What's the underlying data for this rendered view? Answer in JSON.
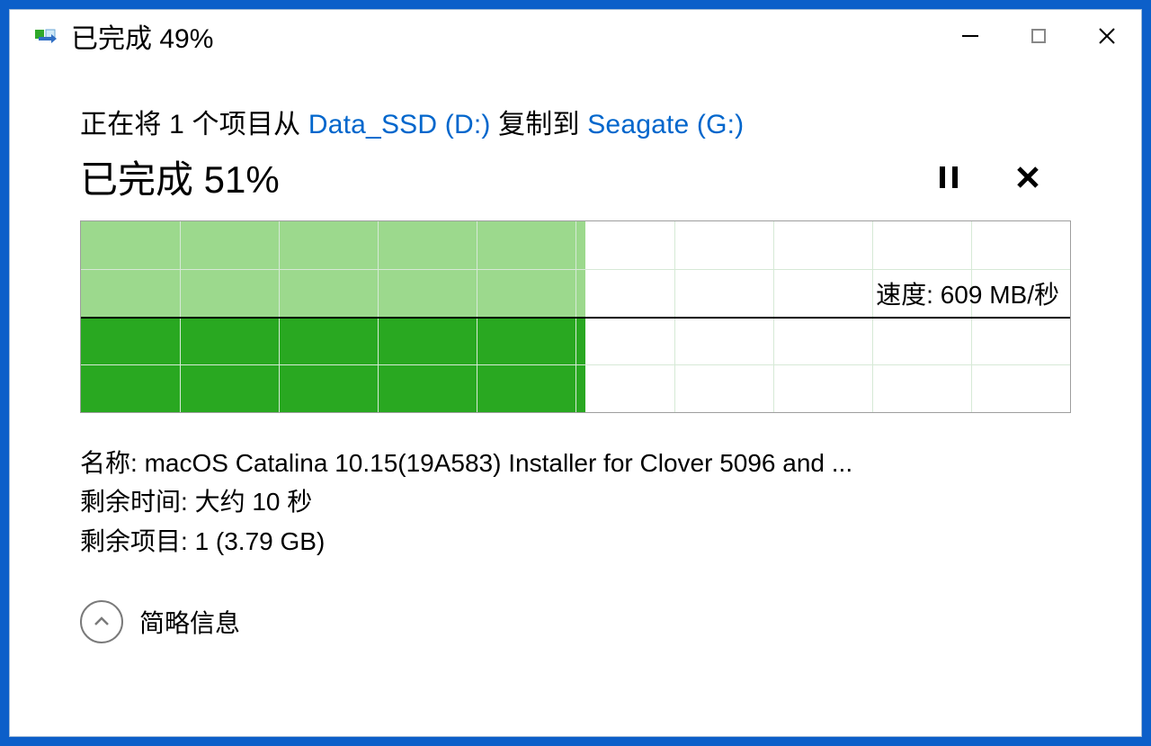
{
  "titlebar": {
    "title": "已完成 49%"
  },
  "copy_line": {
    "prefix": "正在将 1 个项目从 ",
    "source": "Data_SSD (D:)",
    "middle": " 复制到 ",
    "dest": "Seagate (G:)"
  },
  "status": {
    "text": "已完成 51%"
  },
  "progress": {
    "percent": 51,
    "speed_label": "速度:",
    "speed_value": "609 MB/秒"
  },
  "details": {
    "name_label": "名称:",
    "name_value": "macOS Catalina 10.15(19A583) Installer for Clover 5096 and ...",
    "time_label": "剩余时间:",
    "time_value": "大约 10 秒",
    "items_label": "剩余项目:",
    "items_value": "1 (3.79 GB)"
  },
  "toggle": {
    "label": "简略信息"
  }
}
